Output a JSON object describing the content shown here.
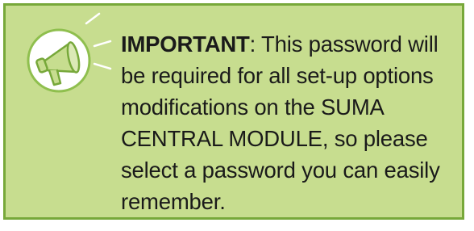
{
  "notice": {
    "icon": "megaphone-icon",
    "emphasis": "IMPORTANT",
    "body": ": This password will be required for all set-up options modifications on the SUMA CENTRAL MODULE, so please select a password you can easily remember."
  },
  "colors": {
    "background": "#c7dd8f",
    "border": "#77a83a",
    "icon_fill": "#ffffff",
    "icon_stroke": "#8fbf4e",
    "text": "#1a1a1a"
  }
}
